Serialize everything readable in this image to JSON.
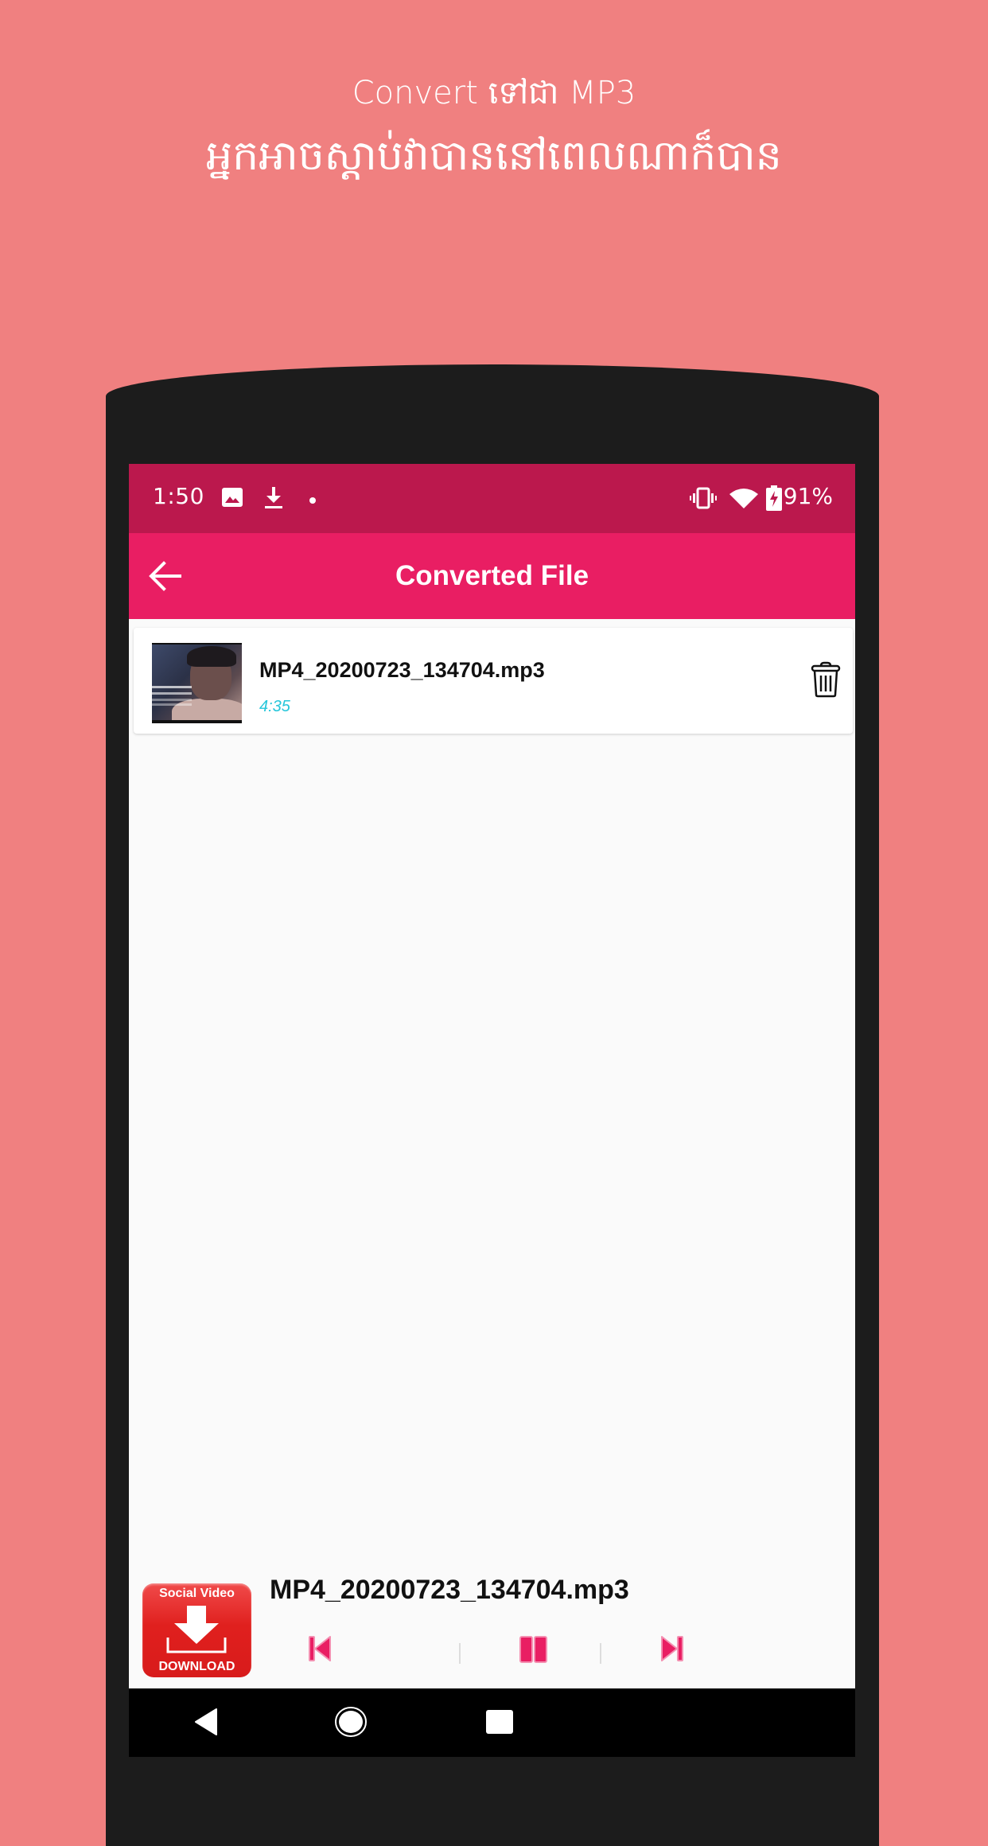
{
  "promo": {
    "line1": "Convert ទៅជា MP3",
    "line2": "អ្នកអាចស្តាប់វាបាននៅពេលណាក៏បាន"
  },
  "status_bar": {
    "time": "1:50",
    "left_icons": [
      "image-icon",
      "download-icon",
      "dot-icon"
    ],
    "right_icons": [
      "vibrate-icon",
      "wifi-icon",
      "battery-charging-icon"
    ],
    "battery": "91%"
  },
  "toolbar": {
    "title": "Converted File",
    "back_icon": "arrow-left-icon"
  },
  "files": [
    {
      "name": "MP4_20200723_134704.mp3",
      "duration": "4:35",
      "thumbnail": "video-thumbnail",
      "action_icon": "trash-icon"
    }
  ],
  "player": {
    "logo": {
      "top_text": "Social Video",
      "bottom_text": "DOWNLOAD"
    },
    "now_playing": "MP4_20200723_134704.mp3",
    "controls": [
      "skip-previous-icon",
      "pause-icon",
      "skip-next-icon"
    ]
  },
  "nav_bar": {
    "buttons": [
      "back-triangle-icon",
      "home-circle-icon",
      "recents-square-icon"
    ]
  },
  "colors": {
    "background": "#f08080",
    "status_bar": "#bb184d",
    "toolbar": "#e91e63",
    "duration_text": "#26c6da",
    "control_accent": "#e91e63",
    "logo_red": "#e0201e"
  }
}
